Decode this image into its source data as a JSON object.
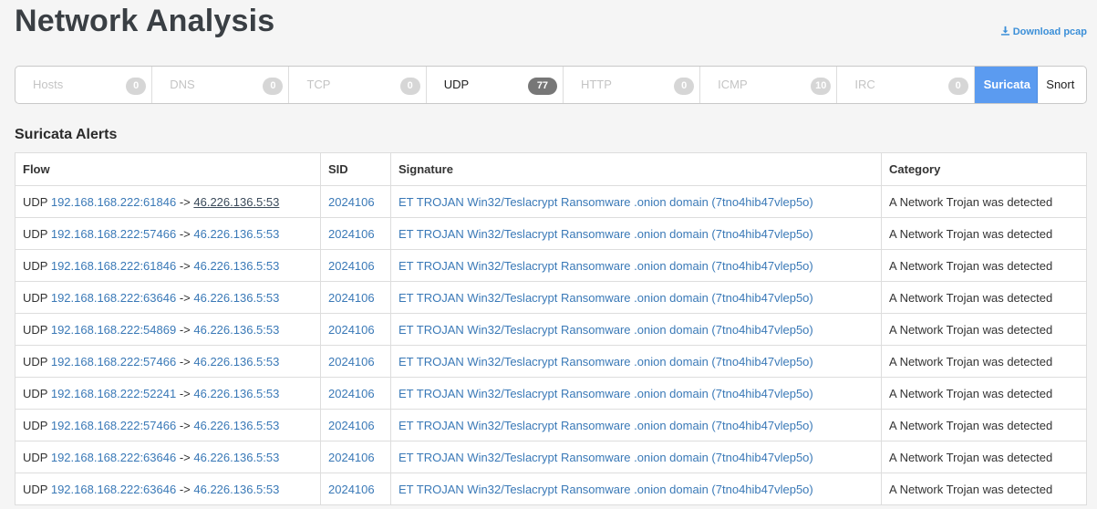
{
  "page": {
    "title": "Network Analysis",
    "download_label": "Download pcap"
  },
  "tabs": [
    {
      "label": "Hosts",
      "count": "0"
    },
    {
      "label": "DNS",
      "count": "0"
    },
    {
      "label": "TCP",
      "count": "0"
    },
    {
      "label": "UDP",
      "count": "77"
    },
    {
      "label": "HTTP",
      "count": "0"
    },
    {
      "label": "ICMP",
      "count": "10"
    },
    {
      "label": "IRC",
      "count": "0"
    },
    {
      "label": "Suricata"
    },
    {
      "label": "Snort"
    }
  ],
  "section_title": "Suricata Alerts",
  "table": {
    "headers": [
      "Flow",
      "SID",
      "Signature",
      "Category"
    ],
    "rows": [
      {
        "proto": "UDP",
        "src": "192.168.168.222:61846",
        "arrow": "->",
        "dst": "46.226.136.5:53",
        "sid": "2024106",
        "signature": "ET TROJAN Win32/Teslacrypt Ransomware .onion domain (7tno4hib47vlep5o)",
        "category": "A Network Trojan was detected"
      },
      {
        "proto": "UDP",
        "src": "192.168.168.222:57466",
        "arrow": "->",
        "dst": "46.226.136.5:53",
        "sid": "2024106",
        "signature": "ET TROJAN Win32/Teslacrypt Ransomware .onion domain (7tno4hib47vlep5o)",
        "category": "A Network Trojan was detected"
      },
      {
        "proto": "UDP",
        "src": "192.168.168.222:61846",
        "arrow": "->",
        "dst": "46.226.136.5:53",
        "sid": "2024106",
        "signature": "ET TROJAN Win32/Teslacrypt Ransomware .onion domain (7tno4hib47vlep5o)",
        "category": "A Network Trojan was detected"
      },
      {
        "proto": "UDP",
        "src": "192.168.168.222:63646",
        "arrow": "->",
        "dst": "46.226.136.5:53",
        "sid": "2024106",
        "signature": "ET TROJAN Win32/Teslacrypt Ransomware .onion domain (7tno4hib47vlep5o)",
        "category": "A Network Trojan was detected"
      },
      {
        "proto": "UDP",
        "src": "192.168.168.222:54869",
        "arrow": "->",
        "dst": "46.226.136.5:53",
        "sid": "2024106",
        "signature": "ET TROJAN Win32/Teslacrypt Ransomware .onion domain (7tno4hib47vlep5o)",
        "category": "A Network Trojan was detected"
      },
      {
        "proto": "UDP",
        "src": "192.168.168.222:57466",
        "arrow": "->",
        "dst": "46.226.136.5:53",
        "sid": "2024106",
        "signature": "ET TROJAN Win32/Teslacrypt Ransomware .onion domain (7tno4hib47vlep5o)",
        "category": "A Network Trojan was detected"
      },
      {
        "proto": "UDP",
        "src": "192.168.168.222:52241",
        "arrow": "->",
        "dst": "46.226.136.5:53",
        "sid": "2024106",
        "signature": "ET TROJAN Win32/Teslacrypt Ransomware .onion domain (7tno4hib47vlep5o)",
        "category": "A Network Trojan was detected"
      },
      {
        "proto": "UDP",
        "src": "192.168.168.222:57466",
        "arrow": "->",
        "dst": "46.226.136.5:53",
        "sid": "2024106",
        "signature": "ET TROJAN Win32/Teslacrypt Ransomware .onion domain (7tno4hib47vlep5o)",
        "category": "A Network Trojan was detected"
      },
      {
        "proto": "UDP",
        "src": "192.168.168.222:63646",
        "arrow": "->",
        "dst": "46.226.136.5:53",
        "sid": "2024106",
        "signature": "ET TROJAN Win32/Teslacrypt Ransomware .onion domain (7tno4hib47vlep5o)",
        "category": "A Network Trojan was detected"
      },
      {
        "proto": "UDP",
        "src": "192.168.168.222:63646",
        "arrow": "->",
        "dst": "46.226.136.5:53",
        "sid": "2024106",
        "signature": "ET TROJAN Win32/Teslacrypt Ransomware .onion domain (7tno4hib47vlep5o)",
        "category": "A Network Trojan was detected"
      }
    ]
  },
  "icons": {
    "download": "download-icon"
  },
  "colors": {
    "accent": "#5b9bf0",
    "link": "#3a79b7",
    "badge_active": "#777777",
    "badge_inactive": "#d6d6d6"
  }
}
